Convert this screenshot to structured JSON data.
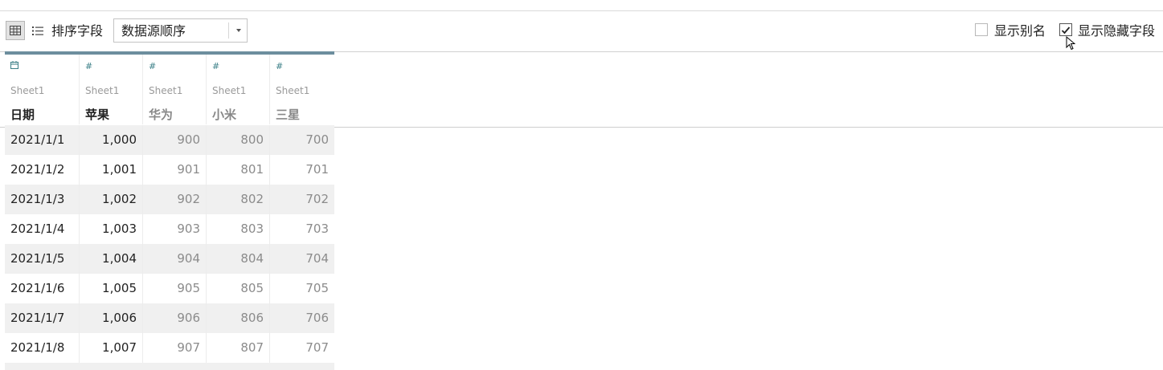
{
  "toolbar": {
    "sort_label": "排序字段",
    "sort_value": "数据源顺序",
    "show_alias_label": "显示别名",
    "show_alias_checked": false,
    "show_hidden_label": "显示隐藏字段",
    "show_hidden_checked": true,
    "grid_view_icon": "grid-icon",
    "list_view_icon": "list-icon"
  },
  "columns": [
    {
      "type_icon": "calendar-icon",
      "type_glyph": "🗓",
      "source": "Sheet1",
      "name": "日期",
      "hidden": false
    },
    {
      "type_icon": "number-icon",
      "type_glyph": "#",
      "source": "Sheet1",
      "name": "苹果",
      "hidden": false
    },
    {
      "type_icon": "number-icon",
      "type_glyph": "#",
      "source": "Sheet1",
      "name": "华为",
      "hidden": true
    },
    {
      "type_icon": "number-icon",
      "type_glyph": "#",
      "source": "Sheet1",
      "name": "小米",
      "hidden": true
    },
    {
      "type_icon": "number-icon",
      "type_glyph": "#",
      "source": "Sheet1",
      "name": "三星",
      "hidden": true
    }
  ],
  "rows": [
    [
      "2021/1/1",
      "1,000",
      "900",
      "800",
      "700"
    ],
    [
      "2021/1/2",
      "1,001",
      "901",
      "801",
      "701"
    ],
    [
      "2021/1/3",
      "1,002",
      "902",
      "802",
      "702"
    ],
    [
      "2021/1/4",
      "1,003",
      "903",
      "803",
      "703"
    ],
    [
      "2021/1/5",
      "1,004",
      "904",
      "804",
      "704"
    ],
    [
      "2021/1/6",
      "1,005",
      "905",
      "805",
      "705"
    ],
    [
      "2021/1/7",
      "1,006",
      "906",
      "806",
      "706"
    ],
    [
      "2021/1/8",
      "1,007",
      "907",
      "807",
      "707"
    ]
  ],
  "colors": {
    "header_accent": "#6d8e9e",
    "type_icon": "#3b7f87",
    "row_stripe": "#f0f0f0"
  }
}
